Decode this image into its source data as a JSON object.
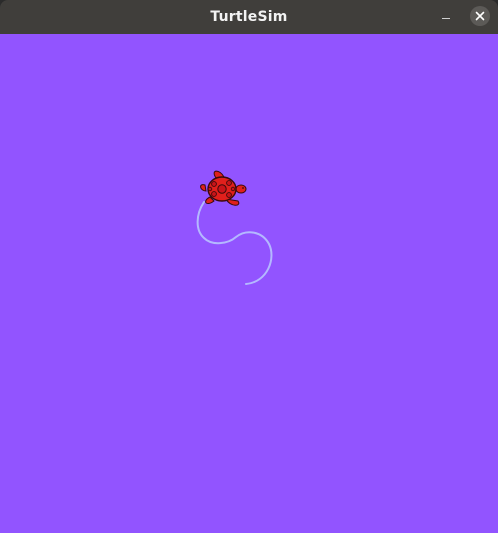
{
  "window": {
    "title": "TurtleSim"
  },
  "titlebar": {
    "minimize_icon": "minimize-icon",
    "close_icon": "close-icon"
  },
  "canvas": {
    "background_color": "#9254ff",
    "pen_color": "#b4b8ff",
    "turtle": {
      "icon": "turtle-icon",
      "shell_color": "#e0201c",
      "outline_color": "#3a0a0a"
    }
  }
}
